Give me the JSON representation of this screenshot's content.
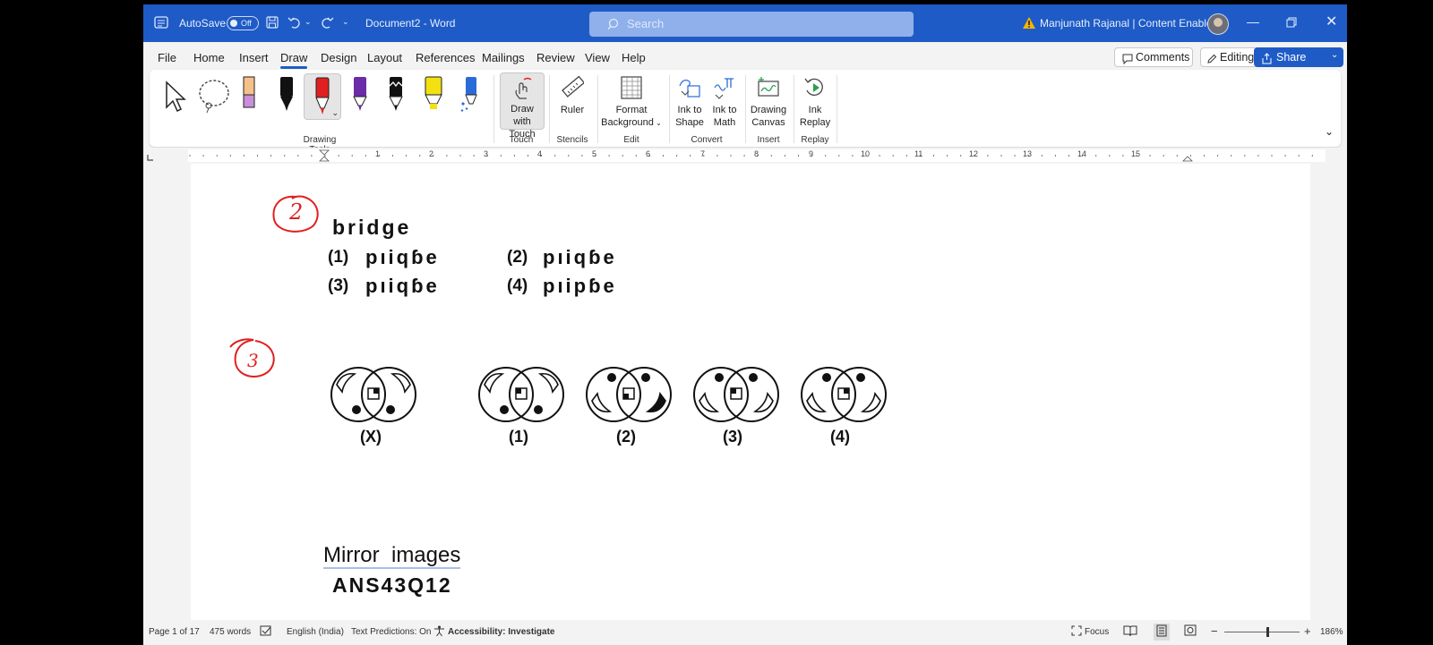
{
  "titlebar": {
    "autosave_label": "AutoSave",
    "autosave_state": "Off",
    "document_title": "Document2 - Word",
    "search_placeholder": "Search",
    "user_name": "Manjunath Rajanal | Content Enablers"
  },
  "menu": {
    "tabs": [
      "File",
      "Home",
      "Insert",
      "Draw",
      "Design",
      "Layout",
      "References",
      "Mailings",
      "Review",
      "View",
      "Help"
    ],
    "active_tab": "Draw",
    "comments_label": "Comments",
    "editing_label": "Editing",
    "share_label": "Share"
  },
  "ribbon": {
    "groups": {
      "drawing_tools": "Drawing Tools",
      "touch": "Touch",
      "stencils": "Stencils",
      "edit": "Edit",
      "convert": "Convert",
      "insert": "Insert",
      "replay": "Replay"
    },
    "buttons": {
      "draw_with_touch_1": "Draw with",
      "draw_with_touch_2": "Touch",
      "ruler": "Ruler",
      "format_bg_1": "Format",
      "format_bg_2": "Background",
      "ink_to_shape_1": "Ink to",
      "ink_to_shape_2": "Shape",
      "ink_to_math_1": "Ink to",
      "ink_to_math_2": "Math",
      "drawing_canvas_1": "Drawing",
      "drawing_canvas_2": "Canvas",
      "ink_replay_1": "Ink",
      "ink_replay_2": "Replay"
    },
    "colors": {
      "pen_red": "#e02020",
      "pen_purple": "#6a2ca8",
      "highlighter_yellow": "#f2e010",
      "pen_blue": "#2a6bd8",
      "pencil_pink": "#c890d8"
    }
  },
  "ruler": {
    "numbers": [
      "1",
      "2",
      "3",
      "4",
      "5",
      "6",
      "7",
      "8",
      "9",
      "10",
      "11",
      "12",
      "13",
      "14",
      "15"
    ]
  },
  "document": {
    "q2": {
      "annotation": "2",
      "word": "bridge",
      "opt1_label": "(1)",
      "opt1_text": "pıiqɓe",
      "opt2_label": "(2)",
      "opt2_text": "pıiqɓe",
      "opt3_label": "(3)",
      "opt3_text": "pıiqɓe",
      "opt4_label": "(4)",
      "opt4_text": "pıipɓe"
    },
    "q3": {
      "annotation": "3",
      "labels": [
        "(X)",
        "(1)",
        "(2)",
        "(3)",
        "(4)"
      ]
    },
    "heading": "Mirror  images",
    "answer_text": "ANS43Q12"
  },
  "status": {
    "page": "Page 1 of 17",
    "words": "475 words",
    "language": "English (India)",
    "text_predictions": "Text Predictions: On",
    "accessibility": "Accessibility: Investigate",
    "focus": "Focus",
    "zoom": "186%"
  }
}
